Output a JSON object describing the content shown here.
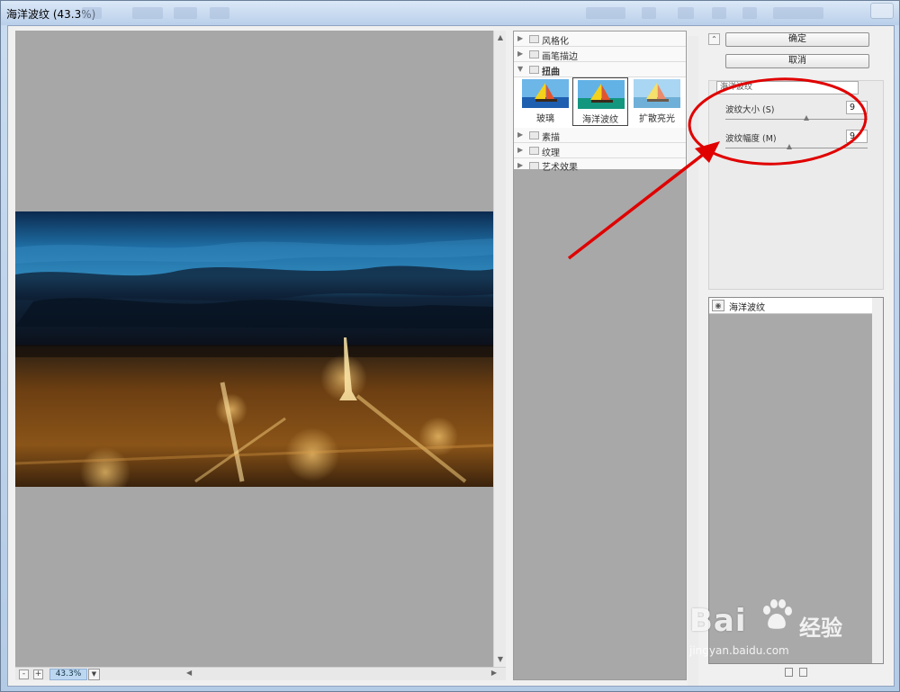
{
  "window": {
    "title": "海洋波纹 (43.3%)"
  },
  "preview": {
    "zoom_value": "43.3%",
    "zoom_minus": "-",
    "zoom_plus": "+"
  },
  "gallery": {
    "categories": [
      {
        "label": "风格化",
        "expanded": false
      },
      {
        "label": "画笔描边",
        "expanded": false
      },
      {
        "label": "扭曲",
        "expanded": true
      },
      {
        "label": "素描",
        "expanded": false
      },
      {
        "label": "纹理",
        "expanded": false
      },
      {
        "label": "艺术效果",
        "expanded": false
      }
    ],
    "filters": [
      {
        "label": "玻璃",
        "selected": false
      },
      {
        "label": "海洋波纹",
        "selected": true
      },
      {
        "label": "扩散亮光",
        "selected": false
      }
    ]
  },
  "settings": {
    "ok_label": "确定",
    "cancel_label": "取消",
    "filter_select": "海洋波纹",
    "params": [
      {
        "label": "波纹大小 (S)",
        "value": "9",
        "slider_fraction": 0.57
      },
      {
        "label": "波纹幅度 (M)",
        "value": "9",
        "slider_fraction": 0.45
      }
    ]
  },
  "layers": [
    {
      "name": "海洋波纹",
      "visible": true
    }
  ],
  "watermark": {
    "brand": "Bai",
    "brand_cn": "经验",
    "url": "jingyan.baidu.com"
  },
  "annotation": {
    "color": "#e00000",
    "shape": "ellipse-with-arrow"
  }
}
